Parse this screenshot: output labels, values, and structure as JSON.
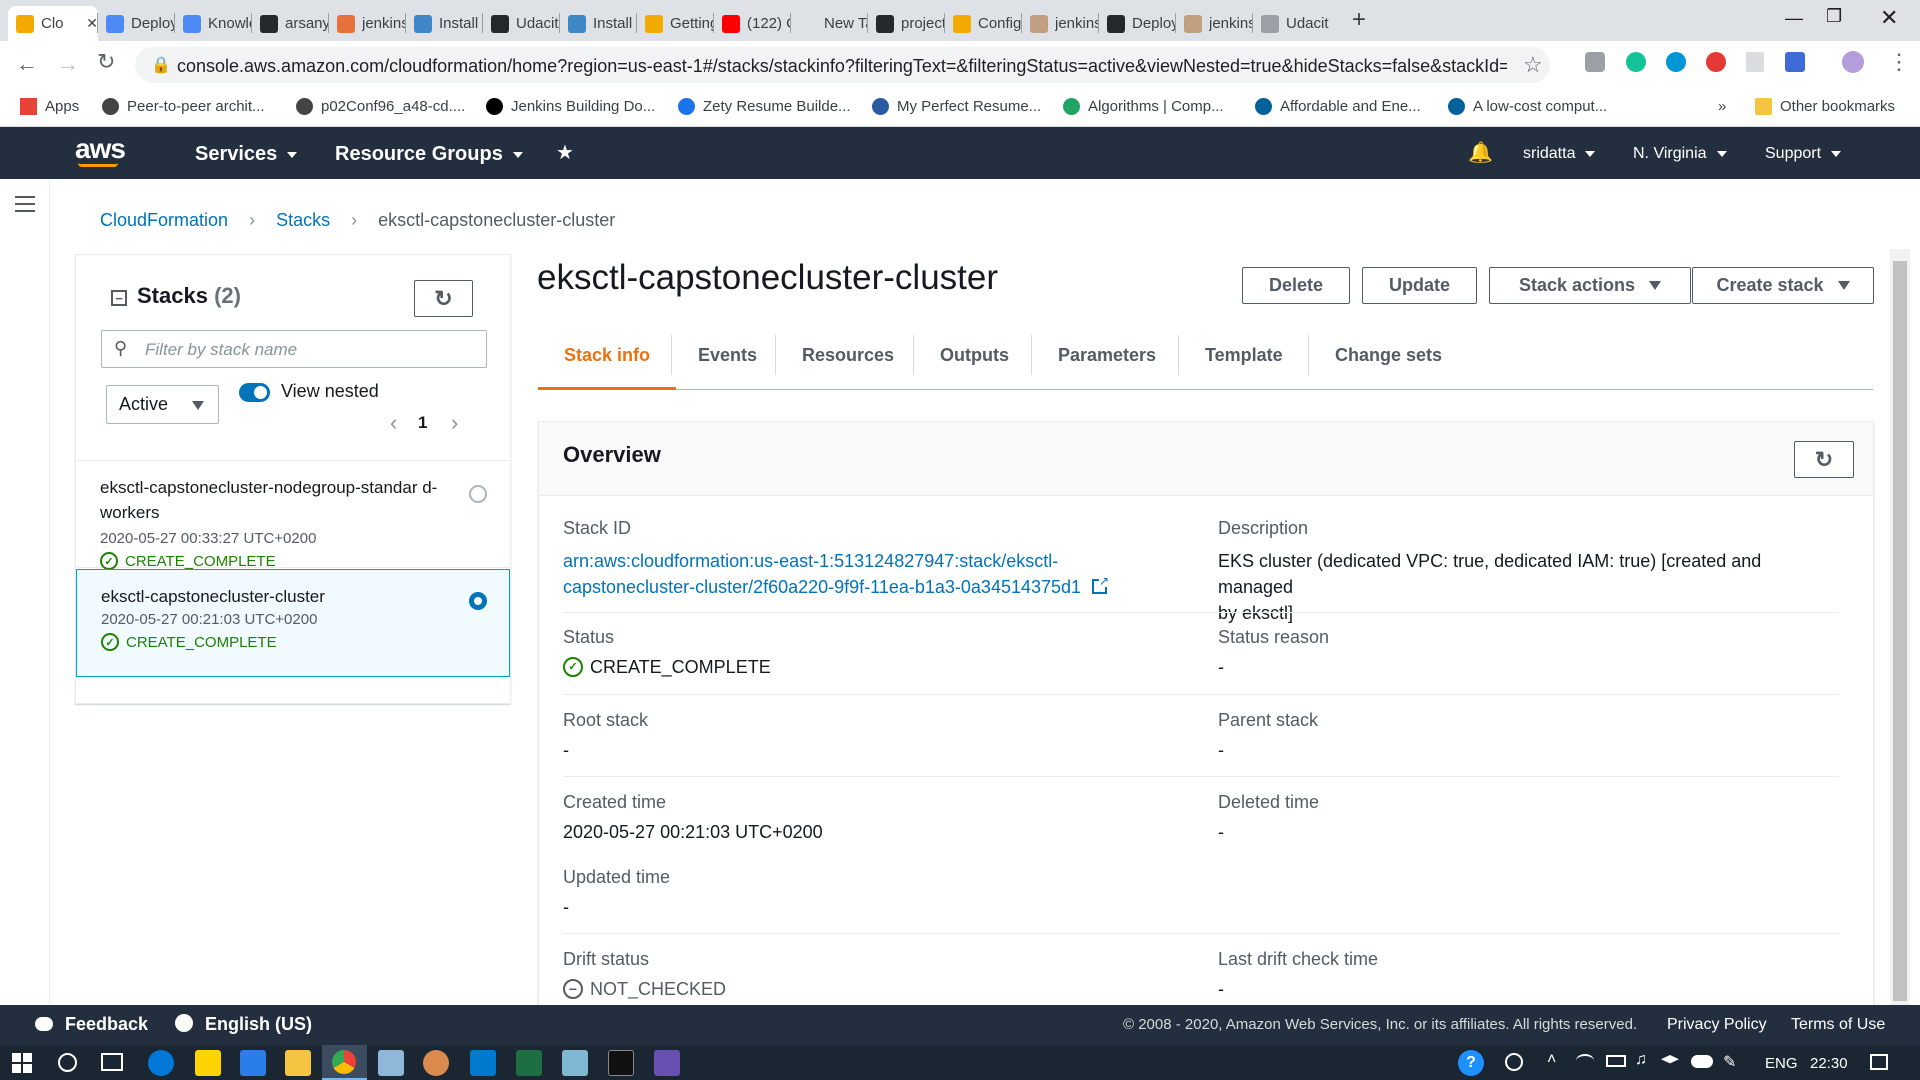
{
  "browser": {
    "tabs": [
      {
        "label": "Clo",
        "fav": "#f2a900"
      },
      {
        "label": "Deploy",
        "fav": "#4c8bf5"
      },
      {
        "label": "Knowle",
        "fav": "#4c8bf5"
      },
      {
        "label": "arsany",
        "fav": "#24292e"
      },
      {
        "label": "jenkins",
        "fav": "#e8703a"
      },
      {
        "label": "Install",
        "fav": "#3f87c5"
      },
      {
        "label": "Udacit",
        "fav": "#24292e"
      },
      {
        "label": "Install",
        "fav": "#3f87c5"
      },
      {
        "label": "Getting",
        "fav": "#f2a900"
      },
      {
        "label": "(122) C",
        "fav": "#ff0000"
      },
      {
        "label": "New Tab",
        "fav": ""
      },
      {
        "label": "project",
        "fav": "#24292e"
      },
      {
        "label": "Config",
        "fav": "#f2a900"
      },
      {
        "label": "jenkins",
        "fav": "#c0a080"
      },
      {
        "label": "Deploy",
        "fav": "#24292e"
      },
      {
        "label": "jenkins",
        "fav": "#c0a080"
      },
      {
        "label": "Udacit",
        "fav": "#9aa0a6"
      }
    ],
    "new_tab": "+",
    "url": "console.aws.amazon.com/cloudformation/home?region=us-east-1#/stacks/stackinfo?filteringText=&filteringStatus=active&viewNested=true&hideStacks=false&stackId=ar...",
    "bookmarks": [
      {
        "label": "Apps",
        "color": "#ea4335"
      },
      {
        "label": "Peer-to-peer archit...",
        "color": "#444"
      },
      {
        "label": "p02Conf96_a48-cd....",
        "color": "#444"
      },
      {
        "label": "Jenkins Building Do...",
        "color": "#000"
      },
      {
        "label": "Zety Resume Builde...",
        "color": "#1a73e8"
      },
      {
        "label": "My Perfect Resume...",
        "color": "#2c5aa0"
      },
      {
        "label": "Algorithms | Comp...",
        "color": "#1fa463"
      },
      {
        "label": "Affordable and Ene...",
        "color": "#00629b"
      },
      {
        "label": "A low-cost comput...",
        "color": "#00629b"
      }
    ],
    "bookmarks_more": "»",
    "other_bookmarks": "Other bookmarks"
  },
  "aws_nav": {
    "logo": "aws",
    "services": "Services",
    "resource_groups": "Resource Groups",
    "user": "sridatta",
    "region": "N. Virginia",
    "support": "Support"
  },
  "breadcrumb": {
    "items": [
      "CloudFormation",
      "Stacks"
    ],
    "current": "eksctl-capstonecluster-cluster"
  },
  "stacks_panel": {
    "title": "Stacks",
    "count": "(2)",
    "filter_placeholder": "Filter by stack name",
    "status_filter": "Active",
    "view_nested_label": "View nested",
    "page": "1",
    "items": [
      {
        "name": "eksctl-capstonecluster-nodegroup-standar d-workers",
        "time": "2020-05-27 00:33:27 UTC+0200",
        "status": "CREATE_COMPLETE",
        "selected": false
      },
      {
        "name": "eksctl-capstonecluster-cluster",
        "time": "2020-05-27 00:21:03 UTC+0200",
        "status": "CREATE_COMPLETE",
        "selected": true
      }
    ]
  },
  "main": {
    "title": "eksctl-capstonecluster-cluster",
    "buttons": {
      "delete": "Delete",
      "update": "Update",
      "stack_actions": "Stack actions",
      "create_stack": "Create stack"
    },
    "tabs": [
      "Stack info",
      "Events",
      "Resources",
      "Outputs",
      "Parameters",
      "Template",
      "Change sets"
    ],
    "active_tab": "Stack info",
    "overview": {
      "title": "Overview",
      "stack_id_label": "Stack ID",
      "stack_id_line1": "arn:aws:cloudformation:us-east-1:513124827947:stack/eksctl-",
      "stack_id_line2": "capstonecluster-cluster/2f60a220-9f9f-11ea-b1a3-0a34514375d1",
      "description_label": "Description",
      "description_line1": "EKS cluster (dedicated VPC: true, dedicated IAM: true) [created and managed",
      "description_line2": "by eksctl]",
      "status_label": "Status",
      "status_value": "CREATE_COMPLETE",
      "status_reason_label": "Status reason",
      "status_reason_value": "-",
      "root_stack_label": "Root stack",
      "root_stack_value": "-",
      "parent_stack_label": "Parent stack",
      "parent_stack_value": "-",
      "created_time_label": "Created time",
      "created_time_value": "2020-05-27 00:21:03 UTC+0200",
      "deleted_time_label": "Deleted time",
      "deleted_time_value": "-",
      "updated_time_label": "Updated time",
      "updated_time_value": "-",
      "drift_status_label": "Drift status",
      "drift_status_value": "NOT_CHECKED",
      "last_drift_label": "Last drift check time",
      "last_drift_value": "-"
    }
  },
  "footer": {
    "feedback": "Feedback",
    "language": "English (US)",
    "copyright": "© 2008 - 2020, Amazon Web Services, Inc. or its affiliates. All rights reserved.",
    "privacy": "Privacy Policy",
    "terms": "Terms of Use"
  },
  "taskbar": {
    "lang": "ENG",
    "time": "22:30"
  },
  "colors": {
    "aws_nav": "#232f3e",
    "accent_orange": "#ec7211",
    "link_blue": "#0073bb",
    "success_green": "#1d8102"
  }
}
